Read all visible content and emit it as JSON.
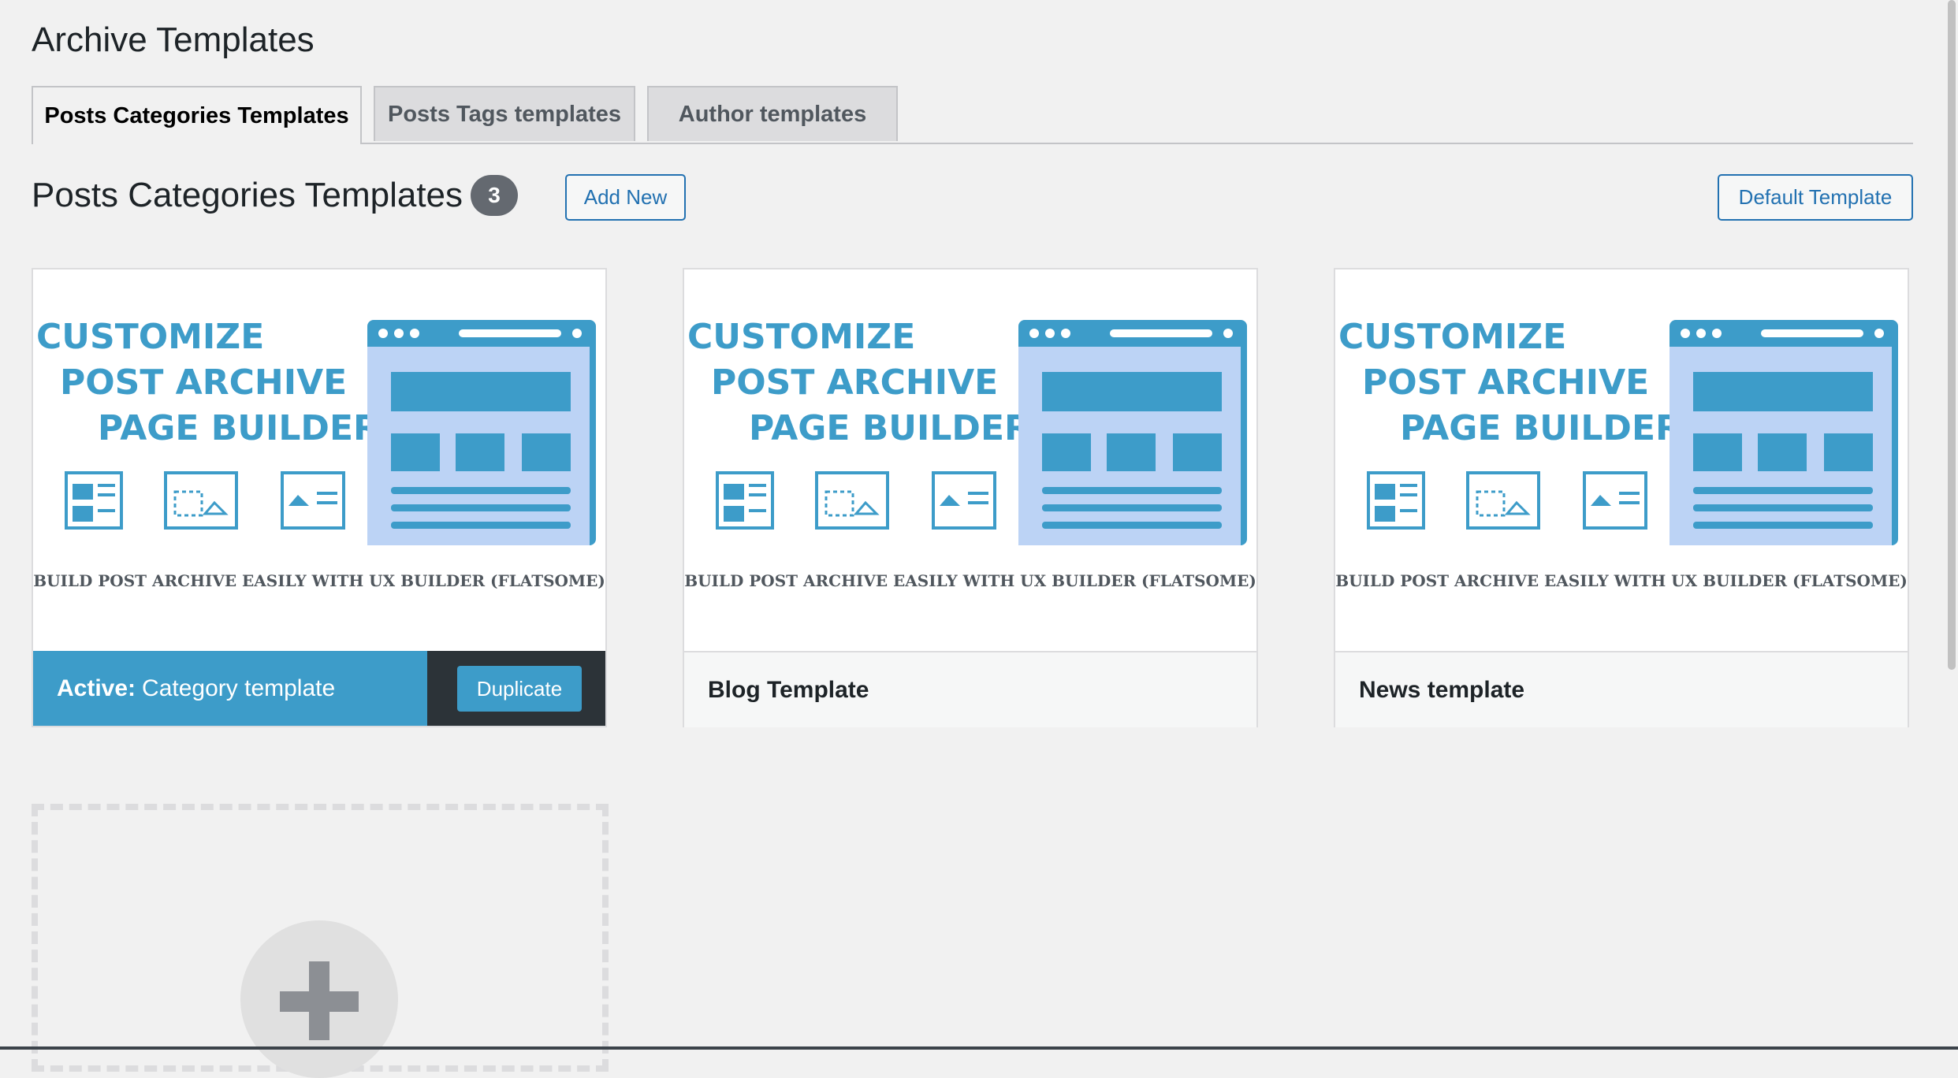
{
  "page": {
    "title": "Archive Templates"
  },
  "tabs": [
    {
      "label": "Posts Categories Templates",
      "active": true
    },
    {
      "label": "Posts Tags templates",
      "active": false
    },
    {
      "label": "Author templates",
      "active": false
    }
  ],
  "section": {
    "title": "Posts Categories Templates",
    "count": "3",
    "add_new_label": "Add New",
    "default_template_label": "Default Template"
  },
  "thumbnail": {
    "line1": "CUSTOMIZE",
    "line2": "POST ARCHIVE",
    "line3": "PAGE BUILDER",
    "caption": "BUILD POST ARCHIVE EASILY WITH UX BUILDER (FLATSOME)"
  },
  "cards": [
    {
      "name": "Category template",
      "active": true,
      "active_prefix": "Active:",
      "duplicate_label": "Duplicate"
    },
    {
      "name": "Blog Template",
      "active": false
    },
    {
      "name": "News template",
      "active": false
    }
  ],
  "add_card": {
    "icon": "plus-icon"
  },
  "colors": {
    "accent": "#3d9cc9",
    "link": "#2271b1",
    "thumb_text": "#3d9cc9",
    "thumb_panel": "#bcd3f5"
  }
}
